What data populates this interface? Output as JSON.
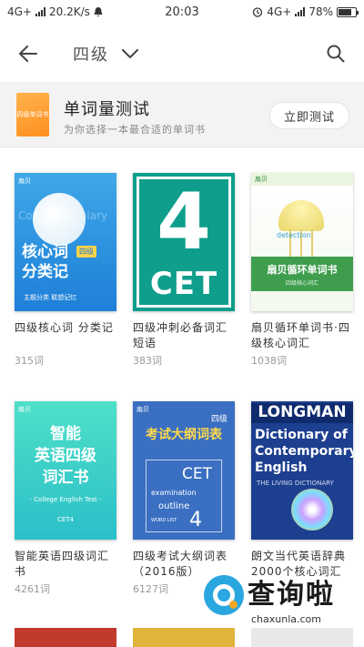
{
  "status_bar": {
    "network_left": "4G+",
    "speed": "20.2K/s",
    "time": "20:03",
    "network_right": "4G+",
    "battery": "78%",
    "battery_level": 0.78
  },
  "header": {
    "title": "四级"
  },
  "vocab_test": {
    "thumb_text": "四级单词书",
    "title": "单词量测试",
    "subtitle": "为你选择一本最合适的单词书",
    "button": "立即测试"
  },
  "books": [
    {
      "title": "四级核心词 分类记",
      "count": "315词",
      "cover": {
        "tag": "扇贝",
        "ghost": "Core Vocabulary",
        "main": "核心词\n分类记",
        "badge": "四级",
        "foot": "主题分类 联想记忆"
      }
    },
    {
      "title": "四级冲刺必备词汇短语",
      "count": "383词",
      "cover": {
        "num": "4",
        "cet": "CET"
      }
    },
    {
      "title": "扇贝循环单词书·四级核心词汇",
      "count": "1038词",
      "cover": {
        "tag": "扇贝",
        "word": "detection",
        "gtitle": "扇贝循环单词书",
        "gsub": "四级核心词汇"
      }
    },
    {
      "title": "智能英语四级词汇书",
      "count": "4261词",
      "cover": {
        "tag": "扇贝",
        "text": "智能\n英语四级\n词汇书",
        "sub": "- College English Test -",
        "sub2": "CET4"
      }
    },
    {
      "title": "四级考试大纲词表（2016版）",
      "count": "6127词",
      "cover": {
        "tag": "扇贝",
        "badge": "四级",
        "title": "考试大纲词表",
        "cet": "CET",
        "l1": "examination",
        "l2": "outline",
        "l3": "WORD LIST",
        "num": "4"
      }
    },
    {
      "title": "朗文当代英语辞典2000个核心词汇",
      "count": "",
      "cover": {
        "brand": "LONGMAN",
        "title": "Dictionary of\nContemporary\nEnglish",
        "sub": "THE LIVING DICTIONARY"
      }
    }
  ],
  "watermark": {
    "text": "查询啦",
    "url": "chaxunla.com"
  }
}
